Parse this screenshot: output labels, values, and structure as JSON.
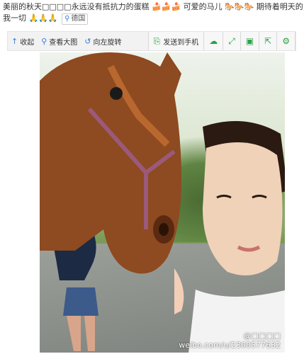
{
  "post": {
    "text_part1": "美丽的秋天□□□□永远没有抵抗力的蛋糕",
    "text_part2": "可爱的马儿",
    "text_part3": "期待着明天的我一切",
    "location": "德国"
  },
  "toolbar": {
    "collapse_label": "收起",
    "view_large_label": "查看大图",
    "rotate_left_label": "向左旋转",
    "send_to_phone_label": "发送到手机"
  },
  "photo": {
    "watermark": "weibo.com/u/2300577632",
    "watermark_user": "@□□□□"
  },
  "colors": {
    "accent_blue": "#3a7bd5",
    "accent_green": "#2aa145"
  }
}
